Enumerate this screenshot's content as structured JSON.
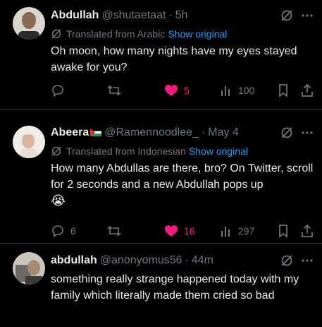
{
  "tweets": [
    {
      "name": "Abdullah",
      "handle": "@shutaetaat",
      "time": "5h",
      "translated_from": "Translated from Arabic",
      "show_original": "Show original",
      "text": "Oh moon, how many nights have my eyes stayed awake for you?",
      "replies": "",
      "reposts": "",
      "likes": "5",
      "views": "100",
      "liked": true
    },
    {
      "name": "Abeera",
      "handle": "@Ramennoodlee_",
      "time": "May 4",
      "translated_from": "Translated from Indonesian",
      "show_original": "Show original",
      "text": "How many Abdullas are there, bro? On Twitter, scroll for 2 seconds and a new Abdullah pops up",
      "emoji": "😭",
      "replies": "6",
      "reposts": "",
      "likes": "16",
      "views": "297",
      "liked": true
    },
    {
      "name": "abdullah",
      "handle": "@anonyomus56",
      "time": "44m",
      "text": "something really strange happened today with my family which literally made them cried so bad"
    }
  ],
  "colors": {
    "background": "#000000",
    "text": "#e7e9ea",
    "muted": "#71767b",
    "link": "#1d9bf0",
    "like": "#f91880",
    "divider": "#2f3336"
  }
}
